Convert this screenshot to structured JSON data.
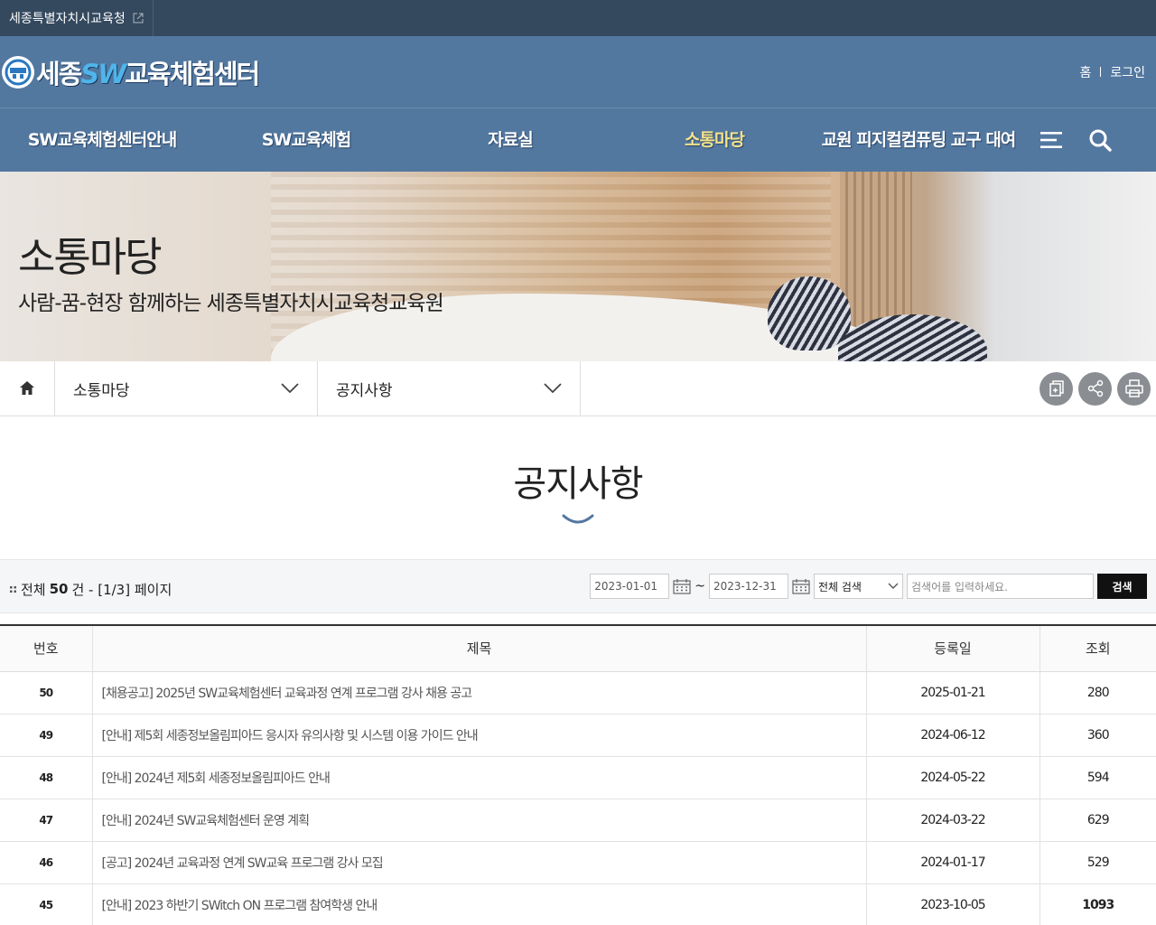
{
  "topbar": {
    "site_link": "세종특별자치시교육청"
  },
  "header": {
    "logo_prefix": "세종",
    "logo_sw": "SW",
    "logo_suffix": "교육체험센터",
    "home": "홈",
    "login": "로그인"
  },
  "nav": {
    "items": [
      {
        "label": "SW교육체험센터안내"
      },
      {
        "label": "SW교육체험"
      },
      {
        "label": "자료실"
      },
      {
        "label": "소통마당"
      },
      {
        "label": "교원 피지컬컴퓨팅 교구 대여"
      }
    ],
    "active_index": 3
  },
  "banner": {
    "title": "소통마당",
    "subtitle": "사람-꿈-현장 함께하는 세종특별자치시교육청교육원"
  },
  "location": {
    "level1": "소통마당",
    "level2": "공지사항"
  },
  "page_title": "공지사항",
  "search": {
    "total_prefix": "전체",
    "total_count": "50",
    "total_suffix": "건 - [1/3] 페이지",
    "date_from": "2023-01-01",
    "tilde": "~",
    "date_to": "2023-12-31",
    "scope": "전체 검색",
    "placeholder": "검색어를 입력하세요.",
    "button": "검색"
  },
  "table": {
    "headers": {
      "no": "번호",
      "title": "제목",
      "date": "등록일",
      "views": "조회"
    },
    "rows": [
      {
        "no": "50",
        "title": "[채용공고] 2025년 SW교육체험센터 교육과정 연계 프로그램 강사 채용 공고",
        "date": "2025-01-21",
        "views": "280"
      },
      {
        "no": "49",
        "title": "[안내] 제5회 세종정보올림피아드 응시자 유의사항 및 시스템 이용 가이드 안내",
        "date": "2024-06-12",
        "views": "360"
      },
      {
        "no": "48",
        "title": "[안내] 2024년 제5회 세종정보올림피아드 안내",
        "date": "2024-05-22",
        "views": "594"
      },
      {
        "no": "47",
        "title": "[안내] 2024년 SW교육체험센터 운영 계획",
        "date": "2024-03-22",
        "views": "629"
      },
      {
        "no": "46",
        "title": "[공고] 2024년 교육과정 연계 SW교육 프로그램 강사 모집",
        "date": "2024-01-17",
        "views": "529"
      },
      {
        "no": "45",
        "title": "[안내] 2023 하반기 SWitch ON 프로그램 참여학생 안내",
        "date": "2023-10-05",
        "views": "1093"
      }
    ]
  }
}
